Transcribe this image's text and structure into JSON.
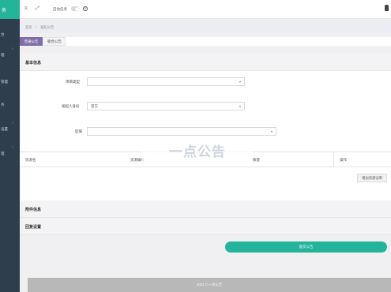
{
  "brand": {
    "name": "务"
  },
  "sidebar": {
    "items": [
      {
        "label": "台",
        "has_arrow": false
      },
      {
        "label": "理",
        "has_arrow": true
      },
      {
        "label": "管理",
        "has_arrow": false
      },
      {
        "label": "务",
        "has_arrow": false
      },
      {
        "label": "设置",
        "has_arrow": true
      },
      {
        "label": "理",
        "has_arrow": true
      }
    ]
  },
  "topbar": {
    "menu_icon": "menu-icon",
    "expand_icon": "expand-icon",
    "task_label": "自动任务",
    "task_toggle_on": false,
    "help_icon": "help-icon",
    "user_icon": "user-icon"
  },
  "breadcrumb": {
    "home": "首页",
    "sep": "/",
    "current": "发起公告"
  },
  "tabs": [
    {
      "label": "普通公告",
      "active": true
    },
    {
      "label": "联合公告",
      "active": false
    }
  ],
  "basic_section": {
    "title": "基本信息"
  },
  "form": {
    "project_type": {
      "label": "项目类型",
      "value": ""
    },
    "initiator_identity": {
      "label": "发起人身份",
      "value": "官方"
    },
    "region": {
      "label": "区域",
      "value": ""
    }
  },
  "resource_table": {
    "columns": [
      "资源名",
      "资源编号",
      "数量",
      "操作"
    ],
    "add_button": "增加资源证明"
  },
  "watermark": "一点公告",
  "attachment_section": {
    "title": "附件信息"
  },
  "reply_section": {
    "title": "回复设置"
  },
  "submit_button": "提交公告",
  "footer": {
    "text": "2021 © 一点公告"
  },
  "colors": {
    "accent": "#24b39b",
    "sidebar": "#2f3e4c",
    "tab_active": "#7e6ea6"
  }
}
